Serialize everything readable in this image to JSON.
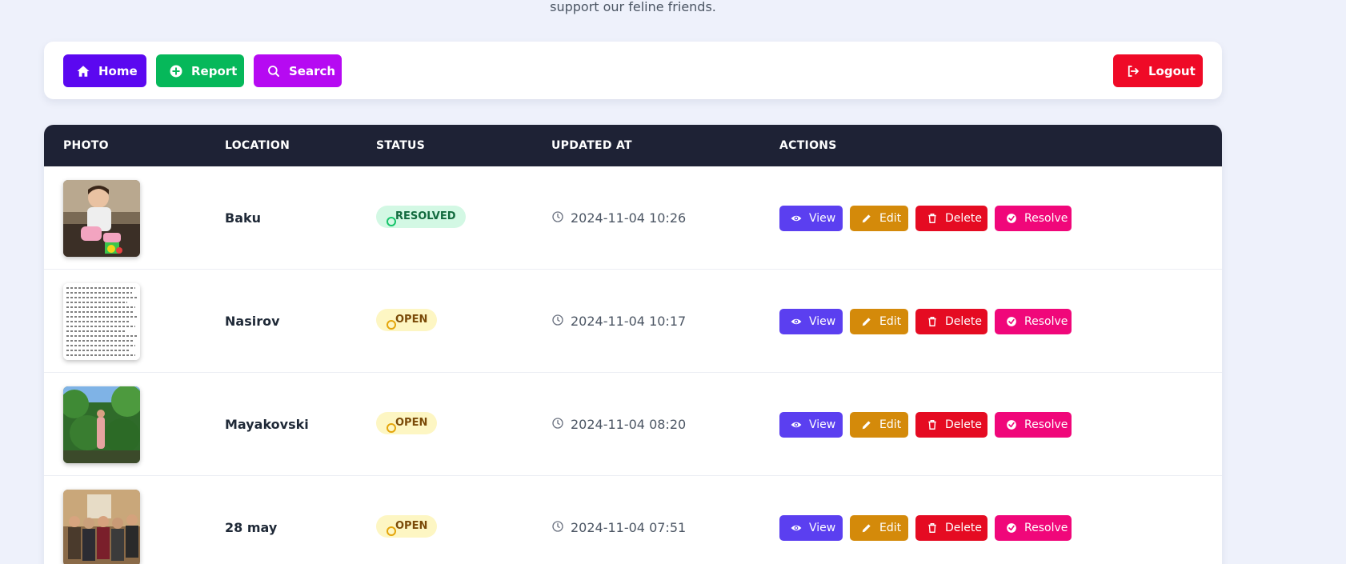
{
  "header": {
    "subtitle": "support our feline friends."
  },
  "nav": {
    "home_label": "Home",
    "report_label": "Report",
    "search_label": "Search",
    "logout_label": "Logout"
  },
  "table": {
    "columns": [
      "PHOTO",
      "LOCATION",
      "STATUS",
      "UPDATED AT",
      "ACTIONS"
    ],
    "rows": [
      {
        "location": "Baku",
        "status": "RESOLVED",
        "updated_at": "2024-11-04 10:26",
        "photo": "child-sitting-photo"
      },
      {
        "location": "Nasirov",
        "status": "OPEN",
        "updated_at": "2024-11-04 10:17",
        "photo": "text-document-photo"
      },
      {
        "location": "Mayakovski",
        "status": "OPEN",
        "updated_at": "2024-11-04 08:20",
        "photo": "garden-photo"
      },
      {
        "location": "28 may",
        "status": "OPEN",
        "updated_at": "2024-11-04 07:51",
        "photo": "group-photo"
      }
    ],
    "actions": {
      "view_label": "View",
      "edit_label": "Edit",
      "delete_label": "Delete",
      "resolve_label": "Resolve"
    }
  },
  "colors": {
    "home": "#5b08f0",
    "report": "#06b85a",
    "search": "#b60af2",
    "logout": "#ef0a27",
    "view": "#5b3ff0",
    "edit": "#d48a0a",
    "delete": "#e50b22",
    "resolve": "#f0077a",
    "table_header": "#1e2235"
  },
  "icons": {
    "home": "home-icon",
    "report": "plus-circle-icon",
    "search": "search-icon",
    "logout": "logout-icon",
    "view": "eye-icon",
    "edit": "pencil-icon",
    "delete": "trash-icon",
    "resolve": "check-circle-icon",
    "updated": "clock-icon"
  }
}
